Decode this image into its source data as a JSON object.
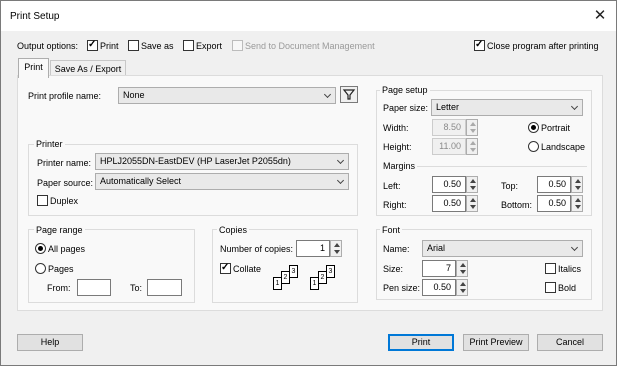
{
  "window": {
    "title": "Print Setup",
    "close_glyph": "✕"
  },
  "output_options": {
    "label": "Output options:",
    "print": "Print",
    "save_as": "Save as",
    "export": "Export",
    "send_to_dm": "Send to Document Management",
    "close_after": "Close program after printing"
  },
  "tabs": [
    "Print",
    "Save As / Export"
  ],
  "print_profile": {
    "label": "Print profile name:",
    "value": "None"
  },
  "printer": {
    "title": "Printer",
    "name_label": "Printer name:",
    "name_value": "HPLJ2055DN-EastDEV (HP LaserJet P2055dn)",
    "source_label": "Paper source:",
    "source_value": "Automatically Select",
    "duplex": "Duplex"
  },
  "page_range": {
    "title": "Page range",
    "all": "All pages",
    "pages": "Pages",
    "from": "From:",
    "to": "To:"
  },
  "copies": {
    "title": "Copies",
    "number_label": "Number of copies:",
    "number_value": "1",
    "collate": "Collate"
  },
  "page_setup": {
    "title": "Page setup",
    "paper_size_label": "Paper size:",
    "paper_size_value": "Letter",
    "width_label": "Width:",
    "width_value": "8.50",
    "height_label": "Height:",
    "height_value": "11.00",
    "portrait": "Portrait",
    "landscape": "Landscape",
    "margins_title": "Margins",
    "left_label": "Left:",
    "left_value": "0.50",
    "right_label": "Right:",
    "right_value": "0.50",
    "top_label": "Top:",
    "top_value": "0.50",
    "bottom_label": "Bottom:",
    "bottom_value": "0.50"
  },
  "font": {
    "title": "Font",
    "name_label": "Name:",
    "name_value": "Arial",
    "size_label": "Size:",
    "size_value": "7",
    "pen_label": "Pen size:",
    "pen_value": "0.50",
    "italics": "Italics",
    "bold": "Bold"
  },
  "buttons": {
    "help": "Help",
    "print": "Print",
    "print_preview": "Print Preview",
    "cancel": "Cancel"
  }
}
